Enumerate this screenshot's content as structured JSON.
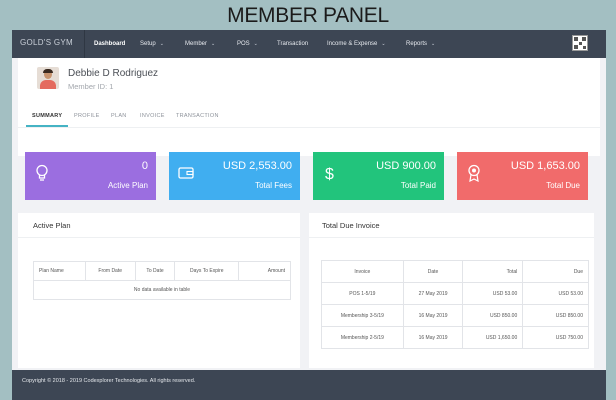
{
  "banner": "MEMBER PANEL",
  "brand": "GOLD'S GYM",
  "nav": [
    {
      "label": "Dashboard"
    },
    {
      "label": "Setup"
    },
    {
      "label": "Member"
    },
    {
      "label": "POS"
    },
    {
      "label": "Transaction"
    },
    {
      "label": "Income & Expense"
    },
    {
      "label": "Reports"
    }
  ],
  "profile": {
    "name": "Debbie D Rodriguez",
    "member_id": "Member ID: 1"
  },
  "tabs": [
    "SUMMARY",
    "PROFILE",
    "PLAN",
    "INVOICE",
    "TRANSACTION"
  ],
  "cards": [
    {
      "value": "0",
      "label": "Active Plan",
      "color": "#9b6ee0",
      "icon": "lightbulb-icon"
    },
    {
      "value": "USD 2,553.00",
      "label": "Total Fees",
      "color": "#40aef0",
      "icon": "wallet-icon"
    },
    {
      "value": "USD 900.00",
      "label": "Total Paid",
      "color": "#22c47c",
      "icon": "dollar-icon"
    },
    {
      "value": "USD 1,653.00",
      "label": "Total Due",
      "color": "#f16b6b",
      "icon": "award-icon"
    }
  ],
  "active_plan": {
    "title": "Active Plan",
    "columns": [
      "Plan Name",
      "From Date",
      "To Date",
      "Days To Expire",
      "Amount"
    ],
    "empty": "No data available in table"
  },
  "due_invoice": {
    "title": "Total Due Invoice",
    "columns": [
      "Invoice",
      "Date",
      "Total",
      "Due"
    ],
    "rows": [
      [
        "POS 1-5/19",
        "27 May 2019",
        "USD 53.00",
        "USD 53.00"
      ],
      [
        "Membership 3-5/19",
        "16 May 2019",
        "USD 850.00",
        "USD 850.00"
      ],
      [
        "Membership 2-5/19",
        "16 May 2019",
        "USD 1,650.00",
        "USD 750.00"
      ]
    ]
  },
  "footer": "Copyright © 2018 - 2019 Codexplorer Technologies. All rights reserved."
}
